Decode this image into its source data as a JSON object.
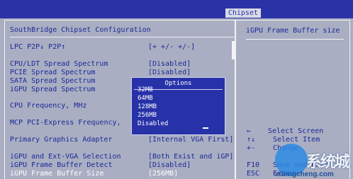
{
  "header": {
    "tab": "Chipset"
  },
  "left": {
    "title": "SouthBridge Chipset Configuration",
    "items": [
      {
        "label": "LPC P2P↓ P2P↑",
        "value": "[+    +/-    +/-]"
      },
      {
        "label": "CPU/LDT Spread Spectrum",
        "value": "[Disabled]"
      },
      {
        "label": "PCIE Spread Spectrum",
        "value": "[Disabled]"
      },
      {
        "label": "SATA Spread Spectrum",
        "value": ""
      },
      {
        "label": "iGPU Spread Spectrum",
        "value": ""
      },
      {
        "label": "CPU Frequency, MHz",
        "value": ""
      },
      {
        "label": "MCP PCI-Express Frequency,",
        "value": ""
      },
      {
        "label": "Primary Graphics Adapter",
        "value": "[Internal VGA First]"
      },
      {
        "label": "iGPU and Ext-VGA Selection",
        "value": "[Both Exist and iGP]"
      },
      {
        "label": "iGPU Frame Buffer Detect",
        "value": "[Disabled]"
      },
      {
        "label": "iGPU Frame Buffer Size",
        "value": "[256MB]"
      }
    ]
  },
  "popup": {
    "title": "Options",
    "options": [
      "32MB",
      "64MB",
      "128MB",
      "256MB",
      "Disabled"
    ]
  },
  "right": {
    "title": "iGPU Frame Buffer size",
    "help": [
      {
        "key": "←",
        "text": "Select Screen"
      },
      {
        "key": "↑↓",
        "text": "Select Item"
      },
      {
        "key": "+-",
        "text": "Change"
      },
      {
        "key": "F10",
        "text": "Save and Exit"
      },
      {
        "key": "ESC",
        "text": "Exit"
      }
    ]
  },
  "watermark": {
    "text": "系统城",
    "url": "xitongcheng.com"
  }
}
